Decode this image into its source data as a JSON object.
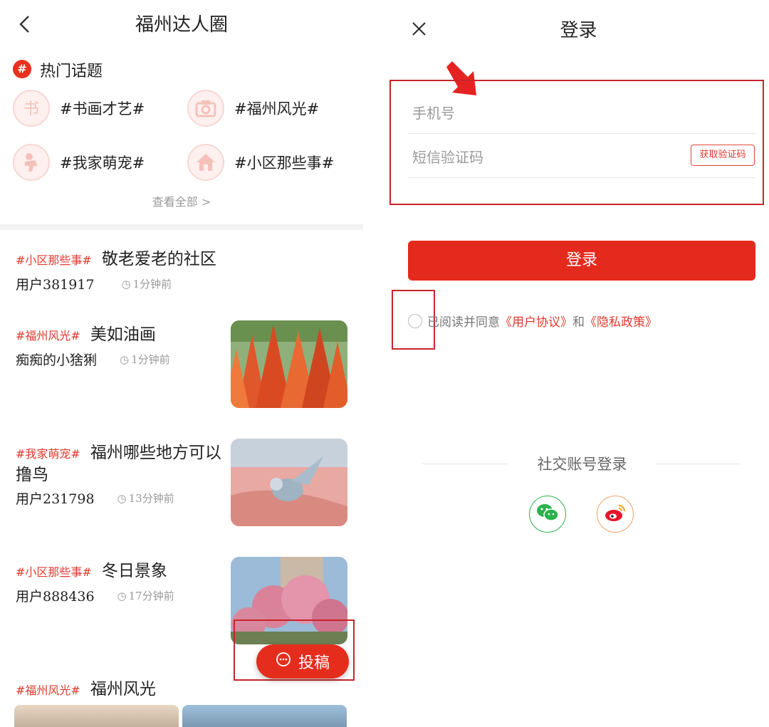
{
  "left": {
    "title": "福州达人圈",
    "hot_badge": "#",
    "hot_label": "热门话题",
    "topics": [
      {
        "label": "#书画才艺#",
        "icon": "calligraphy-icon"
      },
      {
        "label": "#福州风光#",
        "icon": "camera-icon"
      },
      {
        "label": "#我家萌宠#",
        "icon": "pet-icon"
      },
      {
        "label": "#小区那些事#",
        "icon": "house-icon"
      }
    ],
    "view_all": "查看全部 >",
    "posts": [
      {
        "tag": "#小区那些事#",
        "title": "敬老爱老的社区",
        "user": "用户381917",
        "time": "1分钟前"
      },
      {
        "tag": "#福州风光#",
        "title": "美如油画",
        "user": "痴痴的小猞猁",
        "time": "1分钟前"
      },
      {
        "tag": "#我家萌宠#",
        "title": "福州哪些地方可以",
        "title2": "撸鸟",
        "user": "用户231798",
        "time": "13分钟前"
      },
      {
        "tag": "#小区那些事#",
        "title": "冬日景象",
        "user": "用户888436",
        "time": "17分钟前"
      },
      {
        "tag": "#福州风光#",
        "title": "福州风光"
      }
    ],
    "fab_label": "投稿"
  },
  "right": {
    "title": "登录",
    "phone_placeholder": "手机号",
    "code_placeholder": "短信验证码",
    "get_code": "获取验证码",
    "login_button": "登录",
    "agree_prefix": "已阅读并同意",
    "agreement_link": "《用户协议》",
    "agree_and": "和",
    "privacy_link": "《隐私政策》",
    "social_title": "社交账号登录",
    "social": [
      {
        "icon": "wechat-icon",
        "color": "#2bb24c"
      },
      {
        "icon": "weibo-icon",
        "color": "#e6162d"
      }
    ]
  },
  "colors": {
    "accent": "#e42a1c",
    "annotation": "#c8252b"
  }
}
